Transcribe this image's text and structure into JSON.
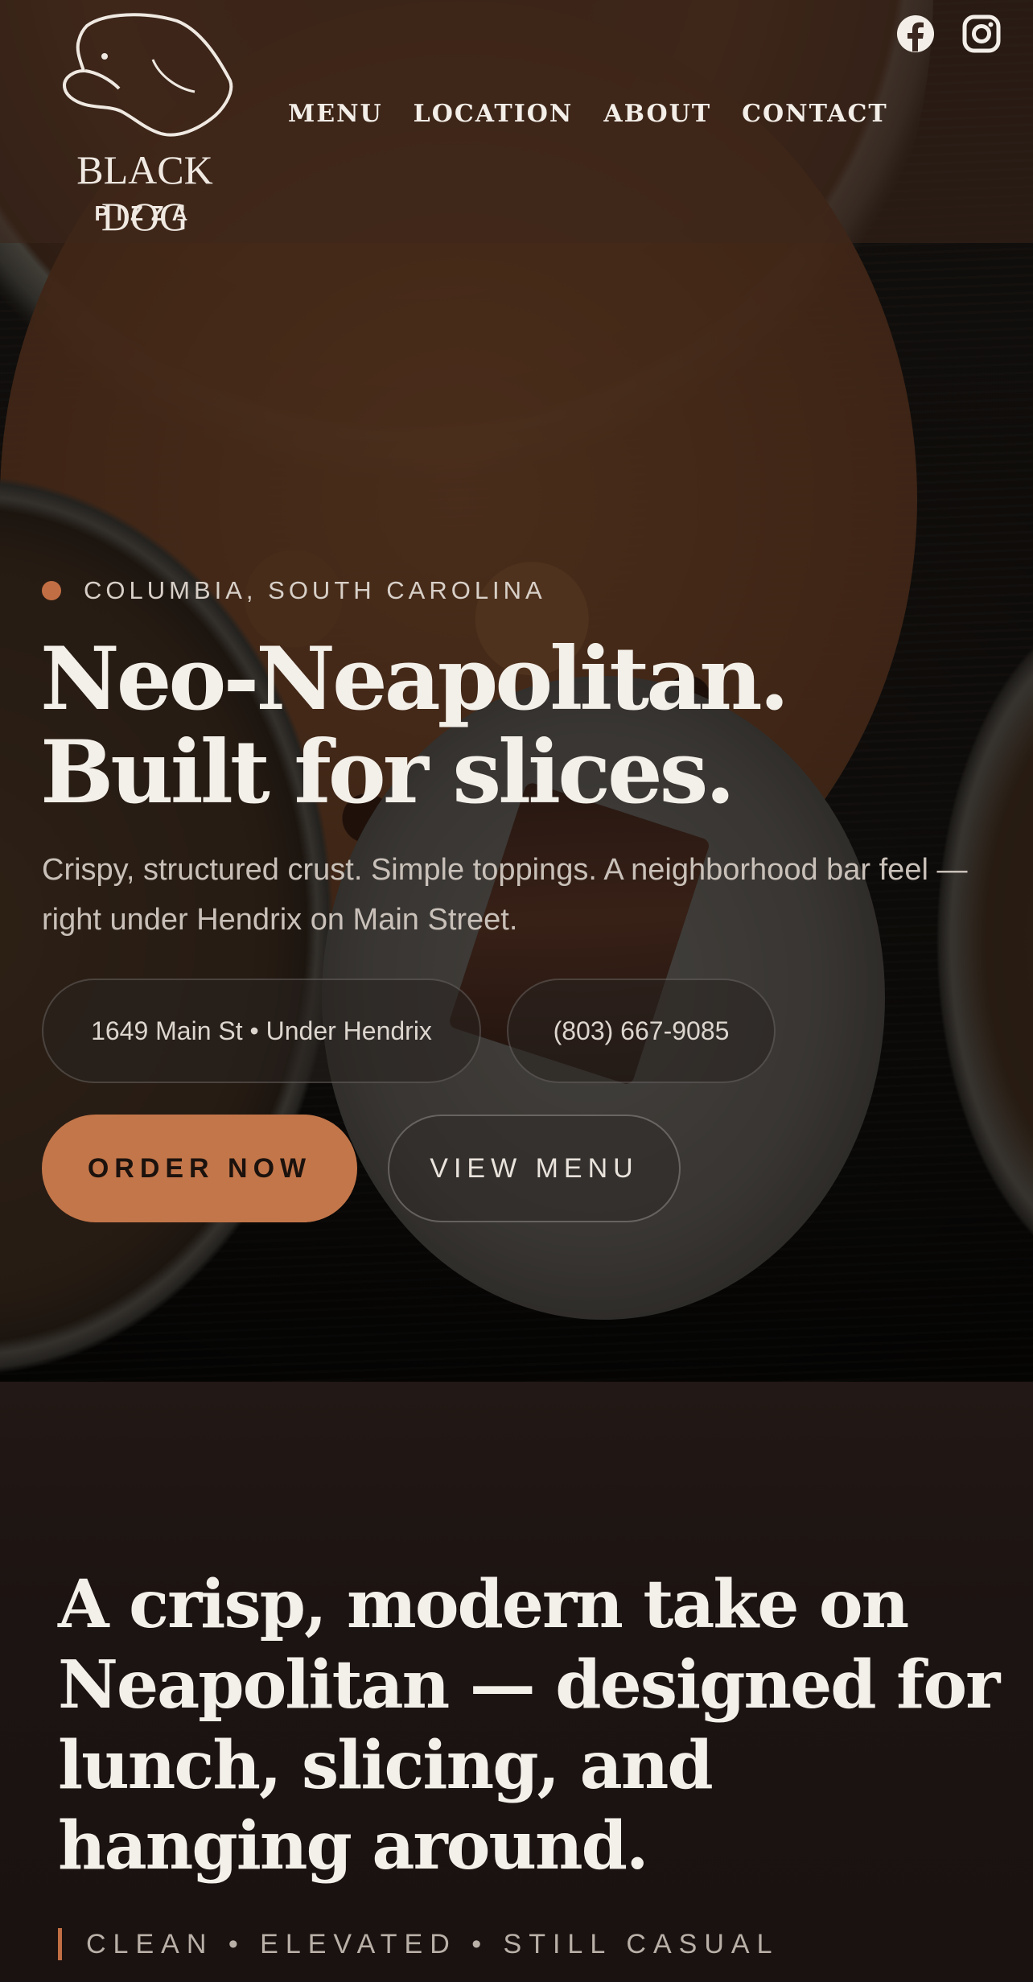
{
  "brand": {
    "name": "BLACK DOG",
    "sub": "PIZZA"
  },
  "nav": {
    "items": [
      {
        "label": "MENU"
      },
      {
        "label": "LOCATION"
      },
      {
        "label": "ABOUT"
      },
      {
        "label": "CONTACT"
      }
    ]
  },
  "social": {
    "facebook_icon": "facebook-icon",
    "instagram_icon": "instagram-icon"
  },
  "hero": {
    "location": "COLUMBIA, SOUTH CAROLINA",
    "headline_line1": "Neo-Neapolitan.",
    "headline_line2": "Built for slices.",
    "subtext": "Crispy, structured crust. Simple toppings. A neighborhood bar feel — right under Hendrix on Main Street.",
    "address_pill": "1649 Main St • Under Hendrix",
    "phone_pill": "(803) 667-9085",
    "order_button": "ORDER NOW",
    "menu_button": "VIEW MENU"
  },
  "intro": {
    "title": "A crisp, modern take on Neapolitan — designed for lunch, slicing, and hanging around.",
    "tagline": "CLEAN • ELEVATED • STILL CASUAL"
  },
  "colors": {
    "accent": "#c3764a",
    "dot": "#c26e44",
    "text": "#f3efe9"
  }
}
